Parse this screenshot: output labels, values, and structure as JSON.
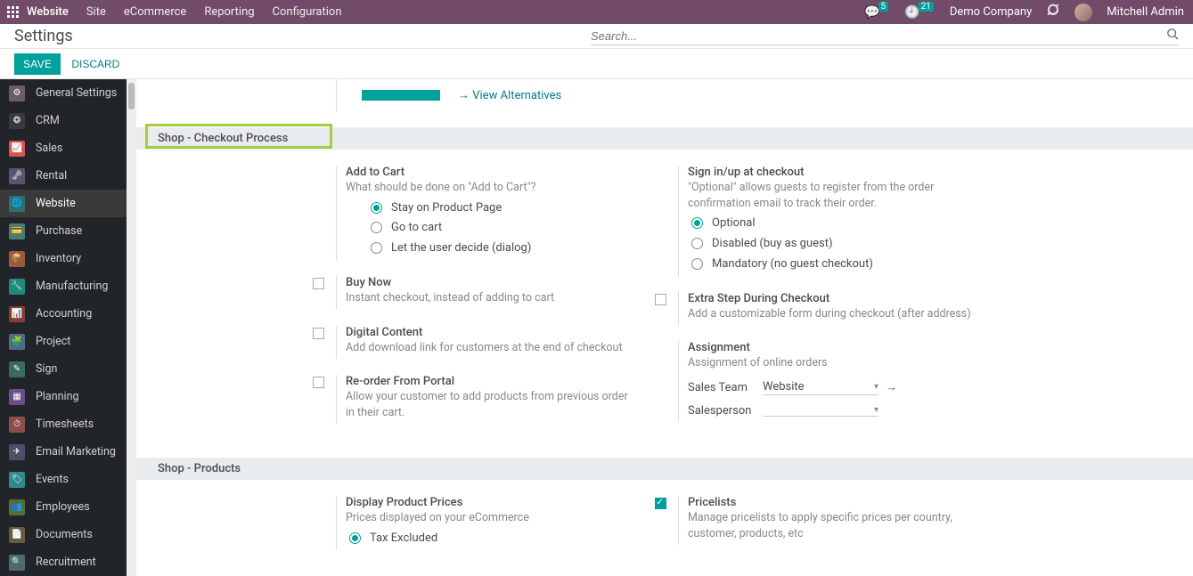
{
  "topbar": {
    "brand": "Website",
    "menu": [
      "Site",
      "eCommerce",
      "Reporting",
      "Configuration"
    ],
    "msg_badge": "5",
    "clock_badge": "21",
    "company": "Demo Company",
    "user": "Mitchell Admin"
  },
  "header": {
    "title": "Settings",
    "search_placeholder": "Search..."
  },
  "actions": {
    "save": "SAVE",
    "discard": "DISCARD"
  },
  "sidebar": {
    "items": [
      {
        "label": "General Settings",
        "color": "#6b5b6b",
        "icon": "⚙"
      },
      {
        "label": "CRM",
        "color": "#3a3a3a",
        "icon": "❂"
      },
      {
        "label": "Sales",
        "color": "#d9534f",
        "icon": "📈"
      },
      {
        "label": "Rental",
        "color": "#5c5470",
        "icon": "🗝"
      },
      {
        "label": "Website",
        "color": "#2f6f6f",
        "icon": "🌐"
      },
      {
        "label": "Purchase",
        "color": "#4a7a7a",
        "icon": "💳"
      },
      {
        "label": "Inventory",
        "color": "#9b5a3c",
        "icon": "📦"
      },
      {
        "label": "Manufacturing",
        "color": "#1f8b7a",
        "icon": "🔧"
      },
      {
        "label": "Accounting",
        "color": "#8b3a3a",
        "icon": "📊"
      },
      {
        "label": "Project",
        "color": "#4e6b8b",
        "icon": "🧩"
      },
      {
        "label": "Sign",
        "color": "#3a6b5a",
        "icon": "✎"
      },
      {
        "label": "Planning",
        "color": "#6b4e8b",
        "icon": "▦"
      },
      {
        "label": "Timesheets",
        "color": "#8b4e4e",
        "icon": "⏱"
      },
      {
        "label": "Email Marketing",
        "color": "#4e4e6b",
        "icon": "✈"
      },
      {
        "label": "Events",
        "color": "#2f8b8b",
        "icon": "🏷"
      },
      {
        "label": "Employees",
        "color": "#5a6b3a",
        "icon": "👥"
      },
      {
        "label": "Documents",
        "color": "#6b5a3a",
        "icon": "📄"
      },
      {
        "label": "Recruitment",
        "color": "#4e6b6b",
        "icon": "🔍"
      }
    ],
    "active_index": 4
  },
  "stripe": {
    "view_alt": "View Alternatives"
  },
  "sections": {
    "checkout": {
      "title": "Shop - Checkout Process",
      "add_to_cart": {
        "title": "Add to Cart",
        "sub": "What should be done on \"Add to Cart\"?",
        "options": [
          "Stay on Product Page",
          "Go to cart",
          "Let the user decide (dialog)"
        ],
        "selected": 0
      },
      "signin": {
        "title": "Sign in/up at checkout",
        "sub": "\"Optional\" allows guests to register from the order confirmation email to track their order.",
        "options": [
          "Optional",
          "Disabled (buy as guest)",
          "Mandatory (no guest checkout)"
        ],
        "selected": 0
      },
      "buy_now": {
        "title": "Buy Now",
        "sub": "Instant checkout, instead of adding to cart"
      },
      "extra_step": {
        "title": "Extra Step During Checkout",
        "sub": "Add a customizable form during checkout (after address)"
      },
      "digital": {
        "title": "Digital Content",
        "sub": "Add download link for customers at the end of checkout"
      },
      "assignment": {
        "title": "Assignment",
        "sub": "Assignment of online orders",
        "sales_team_label": "Sales Team",
        "sales_team_value": "Website",
        "salesperson_label": "Salesperson",
        "salesperson_value": ""
      },
      "reorder": {
        "title": "Re-order From Portal",
        "sub": "Allow your customer to add products from previous order in their cart."
      }
    },
    "products": {
      "title": "Shop - Products",
      "display_prices": {
        "title": "Display Product Prices",
        "sub": "Prices displayed on your eCommerce",
        "options": [
          "Tax Excluded"
        ],
        "selected": 0
      },
      "pricelists": {
        "title": "Pricelists",
        "sub": "Manage pricelists to apply specific prices per country, customer, products, etc"
      }
    }
  }
}
